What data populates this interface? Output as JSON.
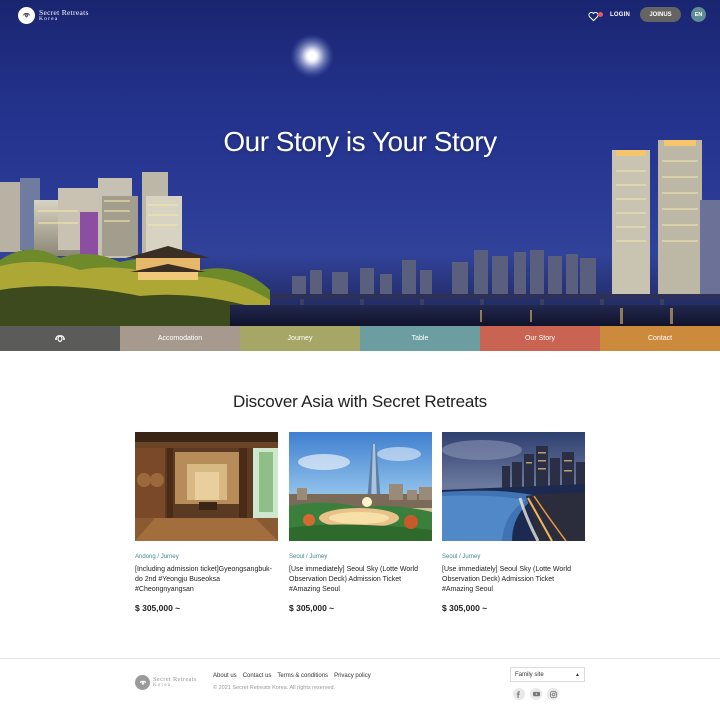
{
  "header": {
    "brand_line1": "Secret Retreats",
    "brand_line2": "Korea",
    "login_label": "LOGIN",
    "join_label": "JOINUS",
    "lang_label": "EN",
    "hero_title": "Our Story is Your Story"
  },
  "menu": {
    "items": [
      {
        "label": "",
        "color": "#5b5b59",
        "icon": "brand-mark-icon"
      },
      {
        "label": "Accomodation",
        "color": "#a69a8f"
      },
      {
        "label": "Journey",
        "color": "#a6a766"
      },
      {
        "label": "Table",
        "color": "#6c9ea1"
      },
      {
        "label": "Our Story",
        "color": "#c96352"
      },
      {
        "label": "Contact",
        "color": "#cc8b3c"
      }
    ]
  },
  "main": {
    "section_title": "Discover Asia with Secret Retreats",
    "cards": [
      {
        "location": "Andong  / Jurney",
        "title": "[Including admission ticket]Gyeongsangbuk-do 2nd #Yeongju Buseoksa #Cheongnyangsan",
        "price": "$ 305,000 ~",
        "image": "hanok-interior"
      },
      {
        "location": "Seoul / Jurney",
        "title": "[Use immediately] Seoul Sky (Lotte World Observation Deck) Admission Ticket #Amazing Seoul",
        "price": "$ 305,000 ~",
        "image": "lotte-tower-sunset"
      },
      {
        "location": "Seoul / Jurney",
        "title": "[Use immediately] Seoul Sky (Lotte World Observation Deck) Admission Ticket #Amazing Seoul",
        "price": "$ 305,000 ~",
        "image": "coastal-city-night"
      }
    ]
  },
  "footer": {
    "brand_line1": "Secret Retreats",
    "brand_line2": "Korea",
    "links": [
      "About us",
      "Contact us",
      "Terms & conditions",
      "Privacy policy"
    ],
    "copyright": "© 2021 Secret Retreats Korea. All rights reserved.",
    "family_site_label": "Family site",
    "socials": [
      "facebook-icon",
      "youtube-icon",
      "instagram-icon"
    ]
  },
  "colors": {
    "accent_teal": "#3f8a94",
    "join_button": "#646463",
    "lang_badge": "#5f8d96"
  }
}
